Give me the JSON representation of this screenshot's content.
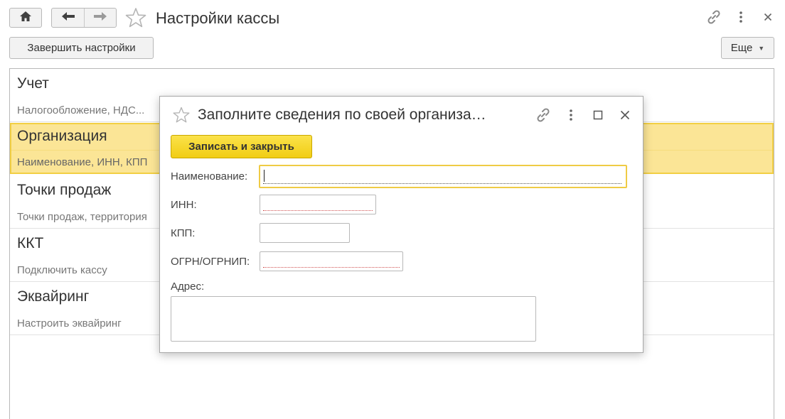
{
  "window": {
    "title": "Настройки кассы",
    "finish_label": "Завершить настройки",
    "more_label": "Еще"
  },
  "sections": [
    {
      "title": "Учет",
      "subtitle": "Налогообложение, НДС..."
    },
    {
      "title": "Организация",
      "subtitle": "Наименование, ИНН, КПП"
    },
    {
      "title": "Точки продаж",
      "subtitle": "Точки продаж, территория"
    },
    {
      "title": "ККТ",
      "subtitle": "Подключить кассу"
    },
    {
      "title": "Эквайринг",
      "subtitle": "Настроить эквайринг"
    }
  ],
  "dialog": {
    "title": "Заполните сведения по своей организа…",
    "save_label": "Записать и закрыть",
    "fields": {
      "name_label": "Наименование:",
      "name_value": "",
      "inn_label": "ИНН:",
      "inn_value": "",
      "kpp_label": "КПП:",
      "kpp_value": "",
      "ogrn_label": "ОГРН/ОГРНИП:",
      "ogrn_value": "",
      "address_label": "Адрес:",
      "address_value": ""
    }
  },
  "colors": {
    "accent_yellow": "#f1cd14",
    "active_row_bg": "#fbe596",
    "active_row_border": "#f2cf43",
    "required_underline": "#d05050"
  }
}
